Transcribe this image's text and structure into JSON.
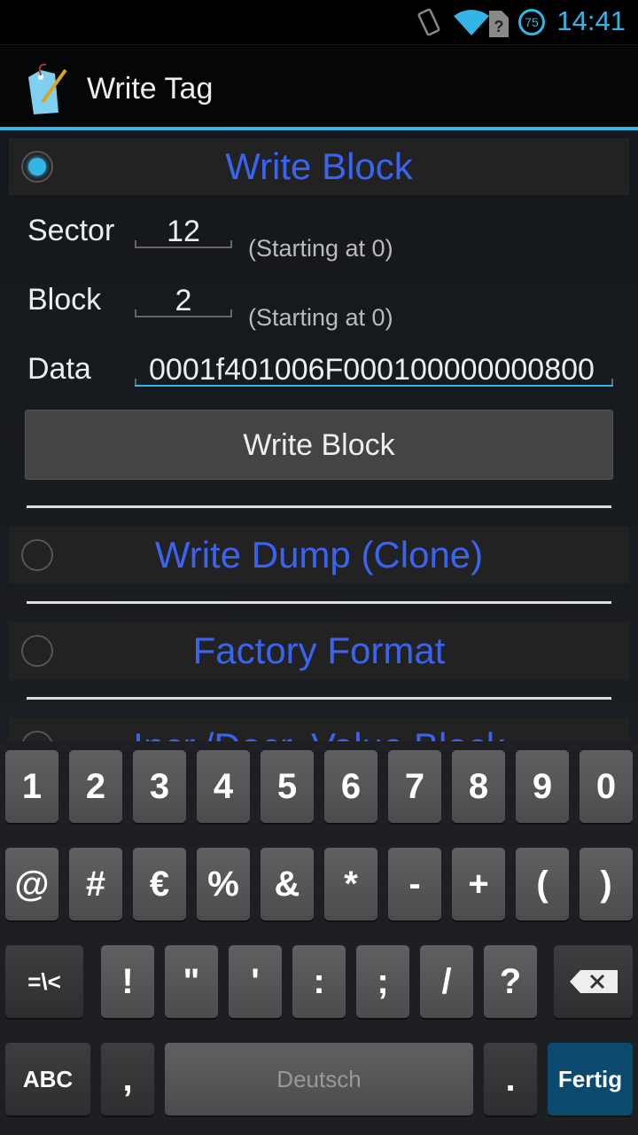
{
  "status_bar": {
    "time": "14:41",
    "battery": "75",
    "icons": [
      "vibrate-icon",
      "wifi-icon",
      "sim-unknown-icon",
      "battery-icon"
    ]
  },
  "action_bar": {
    "title": "Write Tag",
    "icon": "tag-pencil-icon"
  },
  "write_block": {
    "label": "Write Block",
    "selected": true,
    "sector_label": "Sector",
    "sector_value": "12",
    "sector_hint": "(Starting at 0)",
    "block_label": "Block",
    "block_value": "2",
    "block_hint": "(Starting at 0)",
    "data_label": "Data",
    "data_value": "0001f401006F000100000000800",
    "button": "Write Block"
  },
  "options": [
    {
      "label": "Write Dump (Clone)",
      "selected": false
    },
    {
      "label": "Factory Format",
      "selected": false
    },
    {
      "label": "Incr./Decr. Value Block",
      "selected": false
    }
  ],
  "keyboard": {
    "row1": [
      "1",
      "2",
      "3",
      "4",
      "5",
      "6",
      "7",
      "8",
      "9",
      "0"
    ],
    "row2": [
      "@",
      "#",
      "€",
      "%",
      "&",
      "*",
      "-",
      "+",
      "(",
      ")"
    ],
    "row3": [
      "=\\<",
      "!",
      "\"",
      "'",
      ":",
      ";",
      "/",
      "?"
    ],
    "abc": "ABC",
    "comma": ",",
    "space": "Deutsch",
    "period": ".",
    "done": "Fertig",
    "done_color": "#0b4a6e"
  }
}
